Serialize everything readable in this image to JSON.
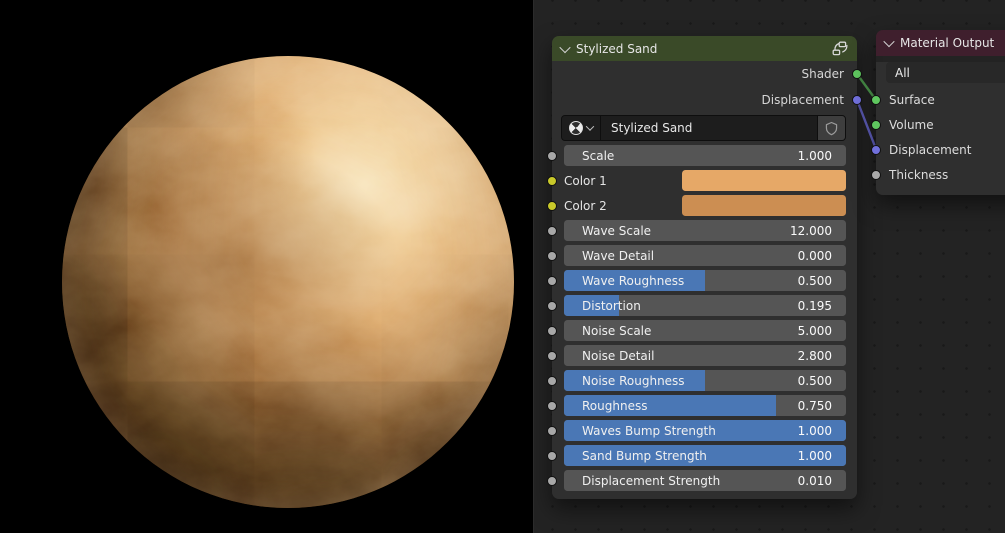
{
  "viewport_preview": {
    "description": "stylized sand sphere render",
    "colors": {
      "highlight": "#f6dfb0",
      "highlight2": "#eec78c",
      "mid1": "#e0aa6a",
      "mid2": "#d09453",
      "mid3": "#ba7d3c",
      "shadow1": "#935d27",
      "shadow2": "#663a16",
      "shadow3": "#3b2009",
      "rim": "#241106"
    }
  },
  "node_editor": {
    "background": "#232323",
    "slider_color": "#4a77b5",
    "socket_colors": {
      "shader": "#5fc75f",
      "vector": "#7170dc",
      "value": "#a8a8a8",
      "color": "#c9c92a"
    },
    "links": [
      {
        "from": "Shader",
        "to": "Surface",
        "color": "#4f9e4f"
      },
      {
        "from": "Displacement",
        "to": "Displacement",
        "color": "#6362c4"
      }
    ],
    "stylized_sand_node": {
      "title": "Stylized Sand",
      "header_color": "#3a4a28",
      "header_icons": [
        "chevron-down-icon",
        "node-group-icon"
      ],
      "outputs": [
        {
          "label": "Shader",
          "socket": "shader"
        },
        {
          "label": "Displacement",
          "socket": "vector"
        }
      ],
      "name_field": {
        "value": "Stylized Sand",
        "icons": [
          "material-ball-icon",
          "chevron-down-icon",
          "shield-icon"
        ]
      },
      "params": [
        {
          "label": "Scale",
          "value": "1.000",
          "type": "value",
          "socket": "value"
        },
        {
          "label": "Color 1",
          "type": "color",
          "swatch": "#e6a867",
          "socket": "color"
        },
        {
          "label": "Color 2",
          "type": "color",
          "swatch": "#cc8e52",
          "socket": "color"
        },
        {
          "label": "Wave Scale",
          "value": "12.000",
          "type": "value",
          "socket": "value"
        },
        {
          "label": "Wave Detail",
          "value": "0.000",
          "type": "value",
          "socket": "value"
        },
        {
          "label": "Wave Roughness",
          "value": "0.500",
          "type": "slider",
          "fill": 0.5,
          "socket": "value"
        },
        {
          "label": "Distortion",
          "value": "0.195",
          "type": "slider",
          "fill": 0.195,
          "socket": "value"
        },
        {
          "label": "Noise Scale",
          "value": "5.000",
          "type": "value",
          "socket": "value"
        },
        {
          "label": "Noise Detail",
          "value": "2.800",
          "type": "value",
          "socket": "value"
        },
        {
          "label": "Noise Roughness",
          "value": "0.500",
          "type": "slider",
          "fill": 0.5,
          "socket": "value"
        },
        {
          "label": "Roughness",
          "value": "0.750",
          "type": "slider",
          "fill": 0.75,
          "socket": "value"
        },
        {
          "label": "Waves Bump Strength",
          "value": "1.000",
          "type": "slider",
          "fill": 1,
          "socket": "value"
        },
        {
          "label": "Sand Bump Strength",
          "value": "1.000",
          "type": "slider",
          "fill": 1,
          "socket": "value"
        },
        {
          "label": "Displacement Strength",
          "value": "0.010",
          "type": "value",
          "socket": "value"
        }
      ]
    },
    "material_output_node": {
      "title": "Material Output",
      "header_color": "#3f1f2d",
      "target": "All",
      "inputs": [
        {
          "label": "Surface",
          "socket": "shader"
        },
        {
          "label": "Volume",
          "socket": "shader"
        },
        {
          "label": "Displacement",
          "socket": "vector"
        },
        {
          "label": "Thickness",
          "socket": "value"
        }
      ]
    }
  }
}
